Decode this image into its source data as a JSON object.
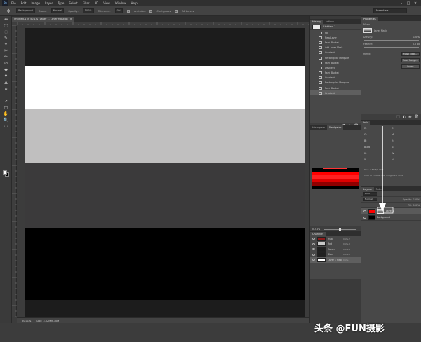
{
  "app": {
    "logo": "Ps"
  },
  "menu": [
    "File",
    "Edit",
    "Image",
    "Layer",
    "Type",
    "Select",
    "Filter",
    "3D",
    "View",
    "Window",
    "Help"
  ],
  "window_controls": [
    "–",
    "□",
    "×"
  ],
  "options_bar": {
    "tool_icon": "move-tool",
    "fields": [
      "Background",
      "Normal",
      "100%",
      "0%"
    ],
    "labels": [
      "Mode:",
      "Opacity:",
      "Tolerance:"
    ],
    "checks": [
      "Anti-alias",
      "Contiguous",
      "All Layers"
    ],
    "workspace": "Essentials"
  },
  "tools": [
    "↔",
    "⬚",
    "◌",
    "✎",
    "⌖",
    "✂",
    "✏",
    "⊘",
    "◆",
    "♦",
    "▲",
    "⌂",
    "T",
    "↗",
    "□",
    "✋",
    "🔍",
    "⋯"
  ],
  "document": {
    "tab_title": "Untitled-1 @ 50.1% (Layer 1, Layer Mask/8)",
    "tab_close": "×",
    "bands": [
      {
        "color": "#1c1c1c",
        "start": 0.0,
        "end": 0.13
      },
      {
        "color": "#ffffff",
        "start": 0.13,
        "end": 0.282
      },
      {
        "color": "#c0bfbf",
        "start": 0.282,
        "end": 0.468
      },
      {
        "color": "#3b3a3b",
        "start": 0.468,
        "end": 0.692
      },
      {
        "color": "#000000",
        "start": 0.692,
        "end": 0.939
      },
      {
        "color": "#1c1c1c",
        "start": 0.939,
        "end": 1.0
      }
    ]
  },
  "status": {
    "zoom": "50.01%",
    "doc_info": "Doc: 3.52M/8.30M"
  },
  "history": {
    "tabs": [
      "History",
      "Actions"
    ],
    "snapshot": "Untitled-1",
    "items": [
      "Fill",
      "New Layer",
      "Paint Bucket",
      "Add Layer Mask",
      "Gradient",
      "Rectangular Marquee",
      "Paint Bucket",
      "Deselect",
      "Paint Bucket",
      "Gradient",
      "Rectangular Marquee",
      "Paint Bucket",
      "Gradient"
    ],
    "selected_index": 12,
    "footer_icons": [
      "⎗",
      "◉",
      "🗑"
    ]
  },
  "navigator": {
    "tabs": [
      "Histogram",
      "Navigator"
    ],
    "zoom": "50.01%",
    "zoom_fraction": 0.45,
    "preview_bands": [
      "#000000",
      "#ff0000",
      "#ff2020",
      "#e00000",
      "#900000",
      "#000000"
    ]
  },
  "channels": {
    "tabs": [
      "Channels"
    ],
    "rows": [
      {
        "name": "RGB",
        "key": "Ctrl+2",
        "thumb": "#8a1c1c"
      },
      {
        "name": "Red",
        "key": "Ctrl+3",
        "thumb": "#c8c8c8"
      },
      {
        "name": "Green",
        "key": "Ctrl+4",
        "thumb": "#202020"
      },
      {
        "name": "Blue",
        "key": "Ctrl+5",
        "thumb": "#202020"
      },
      {
        "name": "Layer 1 Mask",
        "key": "Ctrl+\\",
        "thumb": "#ffffff"
      }
    ],
    "selected_index": 4
  },
  "properties": {
    "tabs": [
      "Properties"
    ],
    "header": "Masks",
    "layer_mask_label": "Layer Mask",
    "density_label": "Density:",
    "density_value": "100%",
    "feather_label": "Feather:",
    "feather_value": "0.0 px",
    "refine_label": "Refine:",
    "buttons": [
      "Mask Edge...",
      "Color Range...",
      "Invert"
    ],
    "footer_icons": [
      "⬚",
      "◐",
      "◉",
      "🗑"
    ]
  },
  "info": {
    "tabs": [
      "Info"
    ],
    "values": [
      "R:",
      "C:",
      "G:",
      "M:",
      "B:",
      "Y:",
      "8-bit",
      "K:",
      "X:",
      "W:",
      "Y:",
      "H:"
    ],
    "doc_line": "Doc: 3.52M/8.30M",
    "hint": "Click to choose new foreground color."
  },
  "layers": {
    "tabs": [
      "Layers",
      "Paths"
    ],
    "kind_label": "Kind",
    "mode": "Normal",
    "opacity_label": "Opacity:",
    "opacity": "100%",
    "fill_label": "Fill:",
    "fill": "100%",
    "rows": [
      {
        "name": "Layer 1",
        "thumb": "#ff0000",
        "has_mask": true
      },
      {
        "name": "Background",
        "thumb": "#000000",
        "has_mask": false
      }
    ],
    "selected_index": 0
  },
  "watermark": "头条 @FUN摄影",
  "colors": {
    "accent": "#ffffff",
    "layer_red": "#ff0000"
  }
}
